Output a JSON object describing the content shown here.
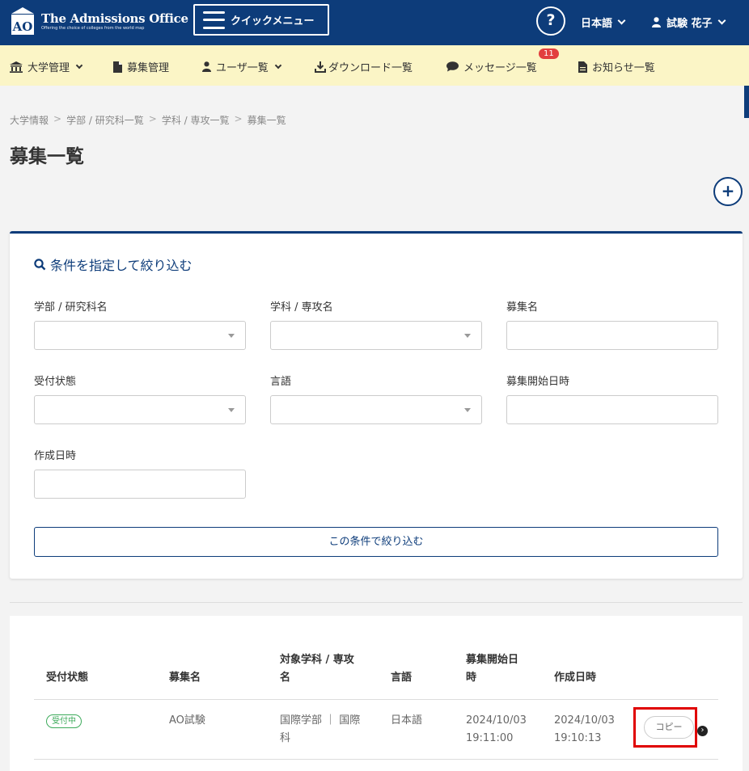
{
  "header": {
    "logo_mark": "AO",
    "logo_title": "The Admissions Office",
    "logo_subtitle": "Offering the choice of colleges from the world map",
    "quick_menu": "クイックメニュー",
    "help": "?",
    "language": "日本語",
    "user_name": "試験 花子"
  },
  "nav": {
    "items": [
      "大学管理",
      "募集管理",
      "ユーザ一覧",
      "ダウンロード一覧",
      "メッセージ一覧",
      "お知らせ一覧"
    ],
    "message_badge": "11"
  },
  "breadcrumb": [
    "大学情報",
    "学部 / 研究科一覧",
    "学科 / 専攻一覧",
    "募集一覧"
  ],
  "breadcrumb_sep": ">",
  "page": {
    "title": "募集一覧",
    "add": "+"
  },
  "filter": {
    "heading": "条件を指定して絞り込む",
    "labels": {
      "faculty": "学部 / 研究科名",
      "department": "学科 / 専攻名",
      "recruitment": "募集名",
      "status": "受付状態",
      "language": "言語",
      "start_date": "募集開始日時",
      "created": "作成日時"
    },
    "values": {
      "faculty": "",
      "department": "",
      "recruitment": "",
      "status": "",
      "language": "",
      "start_date": "",
      "created": ""
    },
    "submit": "この条件で絞り込む"
  },
  "table": {
    "headers": {
      "status": "受付状態",
      "name": "募集名",
      "target_1": "対象学科 / 専攻",
      "target_2": "名",
      "language": "言語",
      "start_1": "募集開始日",
      "start_2": "時",
      "created": "作成日時"
    },
    "rows": [
      {
        "status": "受付中",
        "name": "AO試験",
        "target_1": "国際学部 ｜ 国際",
        "target_2": "科",
        "language": "日本語",
        "start_date": "2024/10/03",
        "start_time": "19:11:00",
        "created_date": "2024/10/03",
        "created_time": "19:10:13",
        "copy": "コピー",
        "arrow": "›"
      }
    ]
  },
  "colors": {
    "primary": "#0d3c7a",
    "nav_bg": "#fbf5c6",
    "badge": "#e23e3e",
    "status_green": "#3caa5a",
    "highlight": "#e00000"
  }
}
